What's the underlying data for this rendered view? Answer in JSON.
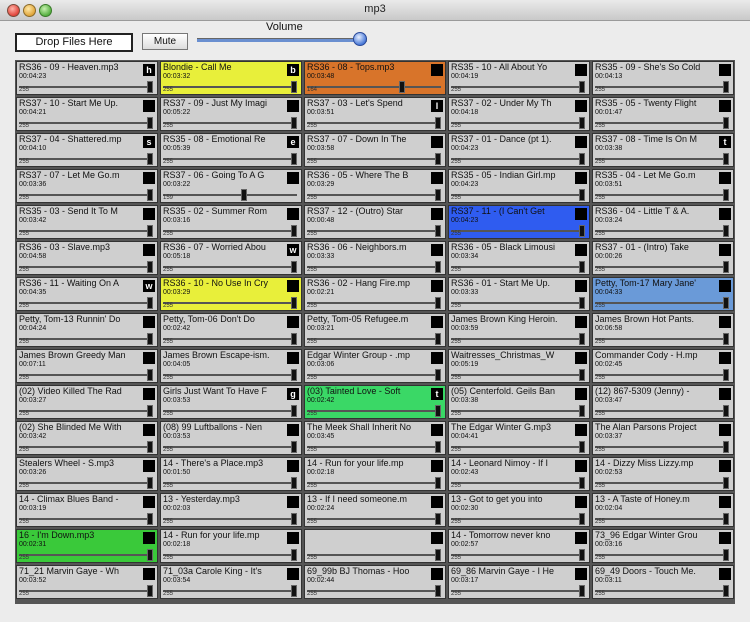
{
  "window": {
    "title": "mp3"
  },
  "controls": {
    "drop_label": "Drop Files Here",
    "mute_label": "Mute",
    "volume_label": "Volume",
    "volume_level": 0.95
  },
  "colors": {
    "default": "#cfcfcf",
    "yellow": "#e8ef3a",
    "orange": "#d8742a",
    "blue": "#2f5cf0",
    "lightblue": "#6a9ad8",
    "green": "#3ad866",
    "brightgreen": "#3ac93a"
  },
  "rows": [
    [
      {
        "name": "RS36 - 09 - Heaven.mp3",
        "time": "00:04:23",
        "key": "h",
        "pos": 1.0,
        "num": "255",
        "color": "default"
      },
      {
        "name": "Blondie - Call Me",
        "time": "00:03:32",
        "key": "b",
        "pos": 1.0,
        "num": "255",
        "color": "yellow"
      },
      {
        "name": "RS36 - 08 - Tops.mp3",
        "time": "00:03:48",
        "key": " ",
        "pos": 0.73,
        "num": "164",
        "color": "orange"
      },
      {
        "name": "RS35 - 10 - All About Yo",
        "time": "00:04:19",
        "key": "",
        "pos": 1.0,
        "num": "255",
        "color": "default"
      },
      {
        "name": "RS35 - 09 - She's So Cold",
        "time": "00:04:13",
        "key": "",
        "pos": 1.0,
        "num": "255",
        "color": "default"
      }
    ],
    [
      {
        "name": "RS37 - 10 - Start Me Up.",
        "time": "00:04:21",
        "key": "",
        "pos": 1.0,
        "num": "255",
        "color": "default"
      },
      {
        "name": "RS37 - 09 - Just My Imagi",
        "time": "00:05:22",
        "key": "",
        "pos": 1.0,
        "num": "255",
        "color": "default"
      },
      {
        "name": "RS37 - 03 - Let's Spend",
        "time": "00:03:51",
        "key": "l",
        "pos": 1.0,
        "num": "255",
        "color": "default"
      },
      {
        "name": "RS37 - 02 - Under My Th",
        "time": "00:04:18",
        "key": "",
        "pos": 1.0,
        "num": "255",
        "color": "default"
      },
      {
        "name": "RS35 - 05 - Twenty Flight",
        "time": "00:01:47",
        "key": "",
        "pos": 1.0,
        "num": "255",
        "color": "default"
      }
    ],
    [
      {
        "name": "RS37 - 04 - Shattered.mp",
        "time": "00:04:10",
        "key": "s",
        "pos": 1.0,
        "num": "255",
        "color": "default"
      },
      {
        "name": "RS35 - 08 - Emotional Re",
        "time": "00:05:39",
        "key": "e",
        "pos": 1.0,
        "num": "255",
        "color": "default"
      },
      {
        "name": "RS37 - 07 - Down In The",
        "time": "00:03:58",
        "key": "",
        "pos": 1.0,
        "num": "255",
        "color": "default"
      },
      {
        "name": "RS37 - 01 - Dance (pt 1).",
        "time": "00:04:23",
        "key": "",
        "pos": 1.0,
        "num": "255",
        "color": "default"
      },
      {
        "name": "RS37 - 08 - Time Is On M",
        "time": "00:03:38",
        "key": "t",
        "pos": 1.0,
        "num": "255",
        "color": "default"
      }
    ],
    [
      {
        "name": "RS37 - 07 - Let Me Go.m",
        "time": "00:03:36",
        "key": "",
        "pos": 1.0,
        "num": "255",
        "color": "default"
      },
      {
        "name": "RS37 - 06 - Going To A G",
        "time": "00:03:22",
        "key": "",
        "pos": 0.62,
        "num": "159",
        "color": "default"
      },
      {
        "name": "RS36 - 05 - Where The B",
        "time": "00:03:29",
        "key": "",
        "pos": 1.0,
        "num": "255",
        "color": "default"
      },
      {
        "name": "RS35 - 05 - Indian Girl.mp",
        "time": "00:04:23",
        "key": "",
        "pos": 1.0,
        "num": "255",
        "color": "default"
      },
      {
        "name": "RS35 - 04 - Let Me Go.m",
        "time": "00:03:51",
        "key": "",
        "pos": 1.0,
        "num": "255",
        "color": "default"
      }
    ],
    [
      {
        "name": "RS35 - 03 - Send It To M",
        "time": "00:03:42",
        "key": "",
        "pos": 1.0,
        "num": "255",
        "color": "default"
      },
      {
        "name": "RS35 - 02 - Summer Rom",
        "time": "00:03:16",
        "key": "",
        "pos": 1.0,
        "num": "255",
        "color": "default"
      },
      {
        "name": "RS37 - 12 - (Outro) Star",
        "time": "00:00:48",
        "key": "",
        "pos": 1.0,
        "num": "255",
        "color": "default"
      },
      {
        "name": "RS37 - 11 - (I Can't Get",
        "time": "00:04:23",
        "key": "",
        "pos": 1.0,
        "num": "255",
        "color": "blue"
      },
      {
        "name": "RS36 - 04 - Little T & A.",
        "time": "00:03:24",
        "key": "",
        "pos": 1.0,
        "num": "255",
        "color": "default"
      }
    ],
    [
      {
        "name": "RS36 - 03 - Slave.mp3",
        "time": "00:04:58",
        "key": "",
        "pos": 1.0,
        "num": "255",
        "color": "default"
      },
      {
        "name": "RS36 - 07 - Worried Abou",
        "time": "00:05:18",
        "key": "w",
        "pos": 1.0,
        "num": "255",
        "color": "default"
      },
      {
        "name": "RS36 - 06 - Neighbors.m",
        "time": "00:03:33",
        "key": "",
        "pos": 1.0,
        "num": "255",
        "color": "default"
      },
      {
        "name": "RS36 - 05 - Black Limousi",
        "time": "00:03:34",
        "key": "",
        "pos": 1.0,
        "num": "255",
        "color": "default"
      },
      {
        "name": "RS37 - 01 - (Intro) Take",
        "time": "00:00:26",
        "key": "",
        "pos": 1.0,
        "num": "255",
        "color": "default"
      }
    ],
    [
      {
        "name": "RS36 - 11 - Waiting On A",
        "time": "00:04:35",
        "key": "w",
        "pos": 1.0,
        "num": "255",
        "color": "default"
      },
      {
        "name": "RS36 - 10 - No Use In Cry",
        "time": "00:03:29",
        "key": "",
        "pos": 1.0,
        "num": "255",
        "color": "yellow"
      },
      {
        "name": "RS36 - 02 - Hang Fire.mp",
        "time": "00:02:21",
        "key": "",
        "pos": 1.0,
        "num": "255",
        "color": "default"
      },
      {
        "name": "RS36 - 01 - Start Me Up.",
        "time": "00:03:33",
        "key": "",
        "pos": 1.0,
        "num": "255",
        "color": "default"
      },
      {
        "name": "Petty, Tom-17 Mary Jane'",
        "time": "00:04:33",
        "key": "",
        "pos": 1.0,
        "num": "255",
        "color": "lightblue"
      }
    ],
    [
      {
        "name": "Petty, Tom-13 Runnin' Do",
        "time": "00:04:24",
        "key": "",
        "pos": 1.0,
        "num": "255",
        "color": "default"
      },
      {
        "name": "Petty, Tom-06 Don't Do",
        "time": "00:02:42",
        "key": "",
        "pos": 1.0,
        "num": "255",
        "color": "default"
      },
      {
        "name": "Petty, Tom-05 Refugee.m",
        "time": "00:03:21",
        "key": "",
        "pos": 1.0,
        "num": "255",
        "color": "default"
      },
      {
        "name": "James Brown King Heroin.",
        "time": "00:03:59",
        "key": "",
        "pos": 1.0,
        "num": "255",
        "color": "default"
      },
      {
        "name": "James Brown Hot Pants.",
        "time": "00:06:58",
        "key": "",
        "pos": 1.0,
        "num": "255",
        "color": "default"
      }
    ],
    [
      {
        "name": "James Brown Greedy Man",
        "time": "00:07:11",
        "key": "",
        "pos": 1.0,
        "num": "255",
        "color": "default"
      },
      {
        "name": "James Brown Escape-ism.",
        "time": "00:04:05",
        "key": "",
        "pos": 1.0,
        "num": "255",
        "color": "default"
      },
      {
        "name": "Edgar Winter Group - .mp",
        "time": "00:03:06",
        "key": "",
        "pos": 1.0,
        "num": "255",
        "color": "default"
      },
      {
        "name": "Waitresses_Christmas_W",
        "time": "00:05:19",
        "key": "",
        "pos": 1.0,
        "num": "255",
        "color": "default"
      },
      {
        "name": "Commander Cody - H.mp",
        "time": "00:02:45",
        "key": "",
        "pos": 1.0,
        "num": "255",
        "color": "default"
      }
    ],
    [
      {
        "name": "(02) Video Killed The Rad",
        "time": "00:03:27",
        "key": "",
        "pos": 1.0,
        "num": "255",
        "color": "default"
      },
      {
        "name": "Girls Just Want To Have F",
        "time": "00:03:53",
        "key": "g",
        "pos": 1.0,
        "num": "255",
        "color": "default"
      },
      {
        "name": "(03) Tainted Love - Soft",
        "time": "00:02:42",
        "key": "t",
        "pos": 1.0,
        "num": "255",
        "color": "green"
      },
      {
        "name": "(05) Centerfold. Geils Ban",
        "time": "00:03:38",
        "key": "",
        "pos": 1.0,
        "num": "255",
        "color": "default"
      },
      {
        "name": "(12) 867-5309 (Jenny) -",
        "time": "00:03:47",
        "key": "",
        "pos": 1.0,
        "num": "255",
        "color": "default"
      }
    ],
    [
      {
        "name": "(02) She Blinded Me With",
        "time": "00:03:42",
        "key": "",
        "pos": 1.0,
        "num": "255",
        "color": "default"
      },
      {
        "name": "(08) 99 Luftballons - Nen",
        "time": "00:03:53",
        "key": "",
        "pos": 1.0,
        "num": "255",
        "color": "default"
      },
      {
        "name": "The Meek Shall Inherit No",
        "time": "00:03:45",
        "key": "",
        "pos": 1.0,
        "num": "255",
        "color": "default"
      },
      {
        "name": "The Edgar Winter G.mp3",
        "time": "00:04:41",
        "key": "",
        "pos": 1.0,
        "num": "255",
        "color": "default"
      },
      {
        "name": "The Alan Parsons Project",
        "time": "00:03:37",
        "key": "",
        "pos": 1.0,
        "num": "255",
        "color": "default"
      }
    ],
    [
      {
        "name": "Stealers Wheel - S.mp3",
        "time": "00:03:26",
        "key": "",
        "pos": 1.0,
        "num": "255",
        "color": "default"
      },
      {
        "name": "14 - There's a Place.mp3",
        "time": "00:01:50",
        "key": "",
        "pos": 1.0,
        "num": "255",
        "color": "default"
      },
      {
        "name": "14 - Run for your life.mp",
        "time": "00:02:18",
        "key": "",
        "pos": 1.0,
        "num": "255",
        "color": "default"
      },
      {
        "name": "14 - Leonard Nimoy - If I",
        "time": "00:02:43",
        "key": "",
        "pos": 1.0,
        "num": "255",
        "color": "default"
      },
      {
        "name": "14 - Dizzy Miss Lizzy.mp",
        "time": "00:02:53",
        "key": "",
        "pos": 1.0,
        "num": "255",
        "color": "default"
      }
    ],
    [
      {
        "name": "14 - Climax Blues Band -",
        "time": "00:03:19",
        "key": "",
        "pos": 1.0,
        "num": "255",
        "color": "default"
      },
      {
        "name": "13 - Yesterday.mp3",
        "time": "00:02:03",
        "key": "",
        "pos": 1.0,
        "num": "255",
        "color": "default"
      },
      {
        "name": "13 - If I need someone.m",
        "time": "00:02:24",
        "key": "",
        "pos": 1.0,
        "num": "255",
        "color": "default"
      },
      {
        "name": "13 - Got to get you into",
        "time": "00:02:30",
        "key": "",
        "pos": 1.0,
        "num": "255",
        "color": "default"
      },
      {
        "name": "13 - A Taste of Honey.m",
        "time": "00:02:04",
        "key": "",
        "pos": 1.0,
        "num": "255",
        "color": "default"
      }
    ],
    [
      {
        "name": "16 - I'm Down.mp3",
        "time": "00:02:31",
        "key": "",
        "pos": 1.0,
        "num": "255",
        "color": "brightgreen"
      },
      {
        "name": "14 - Run for your life.mp",
        "time": "00:02:18",
        "key": "",
        "pos": 1.0,
        "num": "255",
        "color": "default"
      },
      {
        "name": "",
        "time": "",
        "key": "",
        "pos": 1.0,
        "num": "255",
        "color": "default"
      },
      {
        "name": "14 - Tomorrow never kno",
        "time": "00:02:57",
        "key": "",
        "pos": 1.0,
        "num": "255",
        "color": "default"
      },
      {
        "name": "73_96 Edgar Winter Grou",
        "time": "00:03:16",
        "key": "",
        "pos": 1.0,
        "num": "255",
        "color": "default"
      }
    ],
    [
      {
        "name": "71_21 Marvin Gaye - Wh",
        "time": "00:03:52",
        "key": "",
        "pos": 1.0,
        "num": "255",
        "color": "default"
      },
      {
        "name": "71_03a Carole King - It's",
        "time": "00:03:54",
        "key": "",
        "pos": 1.0,
        "num": "255",
        "color": "default"
      },
      {
        "name": "69_99b BJ Thomas - Hoo",
        "time": "00:02:44",
        "key": "",
        "pos": 1.0,
        "num": "255",
        "color": "default"
      },
      {
        "name": "69_86 Marvin Gaye - I He",
        "time": "00:03:17",
        "key": "",
        "pos": 1.0,
        "num": "255",
        "color": "default"
      },
      {
        "name": "69_49 Doors - Touch Me.",
        "time": "00:03:11",
        "key": "",
        "pos": 1.0,
        "num": "255",
        "color": "default"
      }
    ]
  ]
}
